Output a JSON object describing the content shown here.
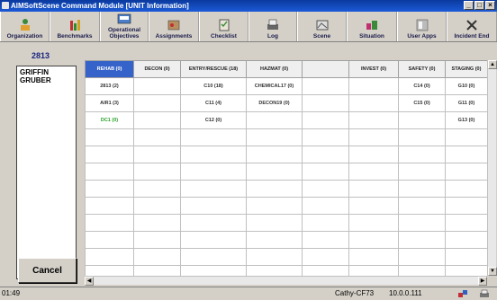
{
  "window": {
    "title": "AlMSoftScene Command Module [UNIT Information]"
  },
  "toolbar": {
    "buttons": [
      {
        "label": "Organization",
        "icon": "organization-icon"
      },
      {
        "label": "Benchmarks",
        "icon": "benchmarks-icon"
      },
      {
        "label": "Operational Objectives",
        "icon": "objectives-icon"
      },
      {
        "label": "Assignments",
        "icon": "assignments-icon"
      },
      {
        "label": "Checklist",
        "icon": "checklist-icon"
      },
      {
        "label": "Log",
        "icon": "log-icon"
      },
      {
        "label": "Scene",
        "icon": "scene-icon"
      },
      {
        "label": "Situation",
        "icon": "situation-icon"
      },
      {
        "label": "User Apps",
        "icon": "user-apps-icon"
      },
      {
        "label": "Incident End",
        "icon": "incident-end-icon"
      }
    ]
  },
  "left": {
    "year": "2813",
    "names": [
      "GRIFFIN",
      "GRUBER"
    ],
    "cancel_label": "Cancel"
  },
  "grid": {
    "headers": [
      "REHAB (0)",
      "DECON (0)",
      "ENTRY/RESCUE (18)",
      "HAZMAT (0)",
      "",
      "INVEST (0)",
      "SAFETY (0)",
      "STAGING (0)"
    ],
    "rows": [
      [
        "2813 (2)",
        "",
        "C10 (18)",
        "CHEMICAL17 (0)",
        "",
        "",
        "C14 (0)",
        "G10 (0)"
      ],
      [
        "AIR1 (3)",
        "",
        "C11 (4)",
        "DECON19 (0)",
        "",
        "",
        "C15 (0)",
        "G11 (0)"
      ],
      [
        "DC1 (0)",
        "",
        "C12 (0)",
        "",
        "",
        "",
        "",
        "G13 (0)"
      ]
    ]
  },
  "status": {
    "time": "01:49",
    "user": "Cathy-CF73",
    "ip": "10.0.0.111"
  },
  "colors": {
    "title_bar": "#1c5ad6",
    "selected_header": "#3563c9",
    "green_text": "#2ca02c",
    "year_text": "#1a237e"
  }
}
